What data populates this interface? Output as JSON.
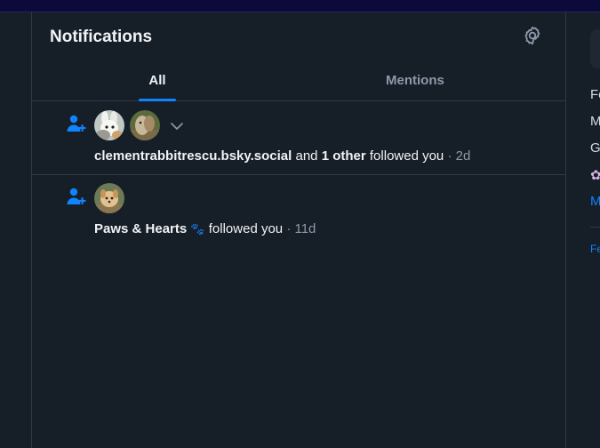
{
  "header": {
    "title": "Notifications"
  },
  "tabs": [
    {
      "label": "All",
      "active": true
    },
    {
      "label": "Mentions",
      "active": false
    }
  ],
  "notifications": [
    {
      "icon": "person-plus-icon",
      "avatars": [
        "rabbit-avatar",
        "alpaca-avatar"
      ],
      "handle": "clementrabbitrescu.bsky.social",
      "connector": "and",
      "others": "1 other",
      "action": "followed you",
      "time": "· 2d"
    },
    {
      "icon": "person-plus-icon",
      "avatars": [
        "dog-avatar"
      ],
      "handle": "Paws & Hearts",
      "handle_emoji": "🐾",
      "action": "followed you",
      "time": "· 11d"
    }
  ],
  "sidebar": {
    "items": [
      "Fe",
      "M",
      "G"
    ],
    "link": "M",
    "footer": "Fe"
  },
  "colors": {
    "background": "#161e27",
    "accent": "#1083fe",
    "muted": "#8d9aab",
    "border": "#2e3a48",
    "topbar": "#0c0a3a"
  }
}
